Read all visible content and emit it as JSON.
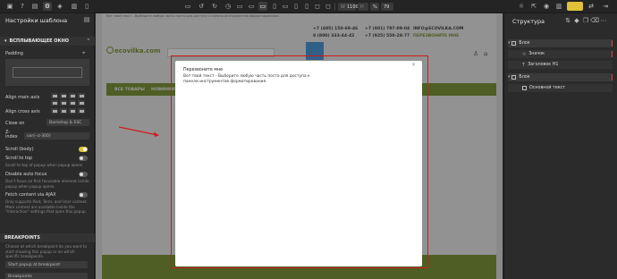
{
  "toolbar": {
    "zoom_value": "1100",
    "zoom_unit": "%",
    "zoom_extra": "79"
  },
  "left_panel": {
    "title": "Настройки шаблона",
    "section_popup": "ВСПЛЫВАЮЩЕЕ ОКНО",
    "padding_label": "Padding",
    "align_main_label": "Align main axis",
    "align_cross_label": "Align cross axis",
    "close_on_label": "Close on",
    "close_on_value": "Backdrop & ESC",
    "z_index_label": "Z-index",
    "z_index_value": "var(--z-300)",
    "scroll_body_label": "Scroll (body)",
    "scroll_to_top_label": "Scroll to top",
    "scroll_to_top_help": "Scroll to top of popup when popup opens.",
    "disable_autofocus_label": "Disable auto focus",
    "disable_autofocus_help": "Don't focus on first focusable element inside popup when popup opens.",
    "fetch_ajax_label": "Fetch content via AJAX",
    "fetch_ajax_help": "Only supports Post, Term, and User context. More context are available inside the \"interaction\" settings that open this popup.",
    "section_breakpoints": "BREAKPOINTS",
    "breakpoints_help": "Choose at which breakpoint do you want to start showing this popup or on which specific breakpoints.",
    "breakpoint_select": "Start popup at breakpoint",
    "breakpoint_select2": "Breakpoints"
  },
  "site": {
    "topline": "Вот твой текст - Выберите любую часть поста для доступа к панели инструментов форматирования.",
    "logo": "ecovilka.com",
    "phone1": "+7 (495) 150-69-46",
    "phone2": "8 (800) 333-44-42",
    "phone3": "+7 (901) 797-09-04",
    "phone4": "+7 (925) 550-28-77",
    "email": "INFO@ECOVILKA.COM",
    "callback": "ПЕРЕЗВОНИТЕ МНЕ",
    "nav1": "ВСЕ ТОВАРЫ",
    "nav2": "НОВИНКИ"
  },
  "popup": {
    "title": "Перезвоните мне",
    "body": "Вот твой текст - Выберите любую часть поста для доступа к панели инструментов форматирования.",
    "close": "×"
  },
  "right_panel": {
    "title": "Структура",
    "tree": [
      {
        "label": "Блок"
      },
      {
        "label": "Значок"
      },
      {
        "label": "Заголовок H1"
      },
      {
        "label": "Блок"
      },
      {
        "label": "Основной текст"
      }
    ]
  },
  "colors": {
    "accent_yellow": "#e2c13a",
    "highlight_red": "#d11a1a",
    "site_green": "#6f8a22"
  }
}
